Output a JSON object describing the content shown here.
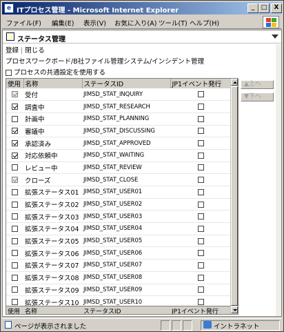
{
  "window": {
    "title": "ITプロセス管理 - Microsoft Internet Explorer",
    "minimize": "_",
    "maximize": "□",
    "close": "X"
  },
  "menu": [
    "ファイル(F)",
    "編集(E)",
    "表示(V)",
    "お気に入り(A)",
    "ツール(T)",
    "ヘルプ(H)"
  ],
  "page": {
    "title": "ステータス管理",
    "links": {
      "register": "登録",
      "close": "閉じる"
    },
    "breadcrumb": "プロセスワークボード/B社ファイル管理システム/インシデント管理",
    "common_setting_label": "プロセスの共通設定を使用する",
    "common_setting_checked": false
  },
  "table": {
    "headers": {
      "use": "使用",
      "name": "名称",
      "status_id": "ステータスID",
      "jp1": "JP1イベント発行"
    },
    "rows": [
      {
        "use": true,
        "use_disabled": true,
        "name": "受付",
        "status_id": "JIMSD_STAT_INQUIRY",
        "jp1": false
      },
      {
        "use": true,
        "use_disabled": false,
        "name": "調査中",
        "status_id": "JIMSD_STAT_RESEARCH",
        "jp1": false
      },
      {
        "use": false,
        "use_disabled": false,
        "name": "計画中",
        "status_id": "JIMSD_STAT_PLANNING",
        "jp1": false
      },
      {
        "use": true,
        "use_disabled": false,
        "name": "審議中",
        "status_id": "JIMSD_STAT_DISCUSSING",
        "jp1": false
      },
      {
        "use": true,
        "use_disabled": false,
        "name": "承認済み",
        "status_id": "JIMSD_STAT_APPROVED",
        "jp1": false
      },
      {
        "use": true,
        "use_disabled": false,
        "name": "対応依頼中",
        "status_id": "JIMSD_STAT_WAITING",
        "jp1": false
      },
      {
        "use": false,
        "use_disabled": false,
        "name": "レビュー中",
        "status_id": "JIMSD_STAT_REVIEW",
        "jp1": false
      },
      {
        "use": true,
        "use_disabled": true,
        "name": "クローズ",
        "status_id": "JIMSD_STAT_CLOSE",
        "jp1": false
      },
      {
        "use": false,
        "use_disabled": false,
        "name": "拡張ステータス01",
        "status_id": "JIMSD_STAT_USER01",
        "jp1": false
      },
      {
        "use": false,
        "use_disabled": false,
        "name": "拡張ステータス02",
        "status_id": "JIMSD_STAT_USER02",
        "jp1": false
      },
      {
        "use": false,
        "use_disabled": false,
        "name": "拡張ステータス03",
        "status_id": "JIMSD_STAT_USER03",
        "jp1": false
      },
      {
        "use": false,
        "use_disabled": false,
        "name": "拡張ステータス04",
        "status_id": "JIMSD_STAT_USER04",
        "jp1": false
      },
      {
        "use": false,
        "use_disabled": false,
        "name": "拡張ステータス05",
        "status_id": "JIMSD_STAT_USER05",
        "jp1": false
      },
      {
        "use": false,
        "use_disabled": false,
        "name": "拡張ステータス06",
        "status_id": "JIMSD_STAT_USER06",
        "jp1": false
      },
      {
        "use": false,
        "use_disabled": false,
        "name": "拡張ステータス07",
        "status_id": "JIMSD_STAT_USER07",
        "jp1": false
      },
      {
        "use": false,
        "use_disabled": false,
        "name": "拡張ステータス08",
        "status_id": "JIMSD_STAT_USER08",
        "jp1": false
      },
      {
        "use": false,
        "use_disabled": false,
        "name": "拡張ステータス09",
        "status_id": "JIMSD_STAT_USER09",
        "jp1": false
      },
      {
        "use": false,
        "use_disabled": false,
        "name": "拡張ステータス10",
        "status_id": "JIMSD_STAT_USER10",
        "jp1": false
      }
    ]
  },
  "side_buttons": {
    "up": "▲上へ",
    "down": "▼下へ"
  },
  "statusbar": {
    "text": "ページが表示されました",
    "zone": "イントラネット"
  }
}
